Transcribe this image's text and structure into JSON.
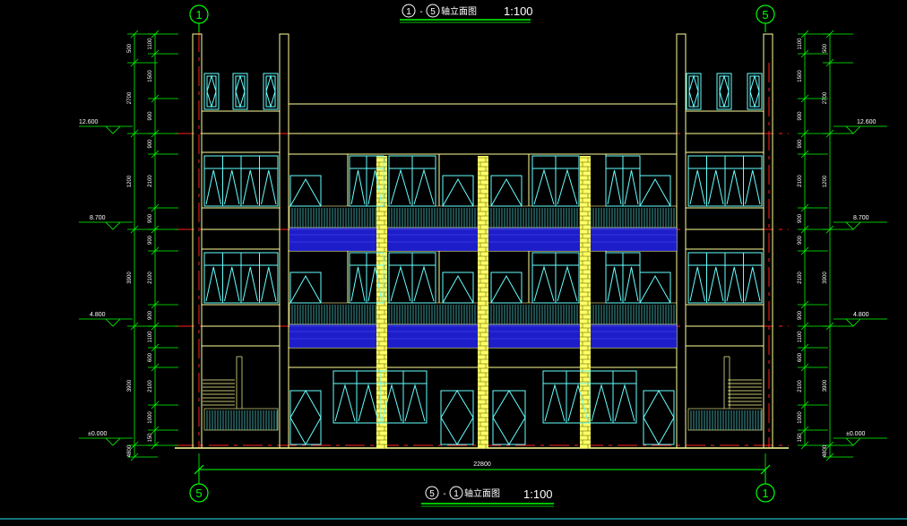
{
  "drawing": {
    "top_title": {
      "from_axis": "1",
      "to_axis": "5",
      "name": "轴立面图",
      "scale": "1:100"
    },
    "bottom_title": {
      "from_axis": "5",
      "to_axis": "1",
      "name": "轴立面图",
      "scale": "1:100"
    },
    "axis_top_left": "1",
    "axis_top_right": "5",
    "axis_bottom_left": "5",
    "axis_bottom_right": "1",
    "overall_width": "22800",
    "elevations": [
      "12.600",
      "8.700",
      "4.800",
      "±0.000"
    ],
    "left_dims_outer": [
      "500",
      "2700",
      "1200",
      "3900",
      "3900",
      "4800",
      "150"
    ],
    "left_dims_inner": [
      "1100",
      "1500",
      "900",
      "900",
      "2100",
      "900",
      "900",
      "2100",
      "900",
      "1100",
      "600",
      "2100",
      "1000",
      "150"
    ],
    "right_dims_outer": [
      "500",
      "2700",
      "1200",
      "3900",
      "3900",
      "4800",
      "150"
    ],
    "right_dims_inner": [
      "1100",
      "1500",
      "900",
      "900",
      "2100",
      "900",
      "900",
      "2100",
      "900",
      "1100",
      "600",
      "2100",
      "1000",
      "150"
    ]
  },
  "colors": {
    "background": "#000000",
    "dimension": "#00ff00",
    "building": "#ffff99",
    "window": "#66ffff",
    "axis_line": "#ff2020",
    "glass_band": "#2020e0",
    "title_text": "#ffffff"
  }
}
